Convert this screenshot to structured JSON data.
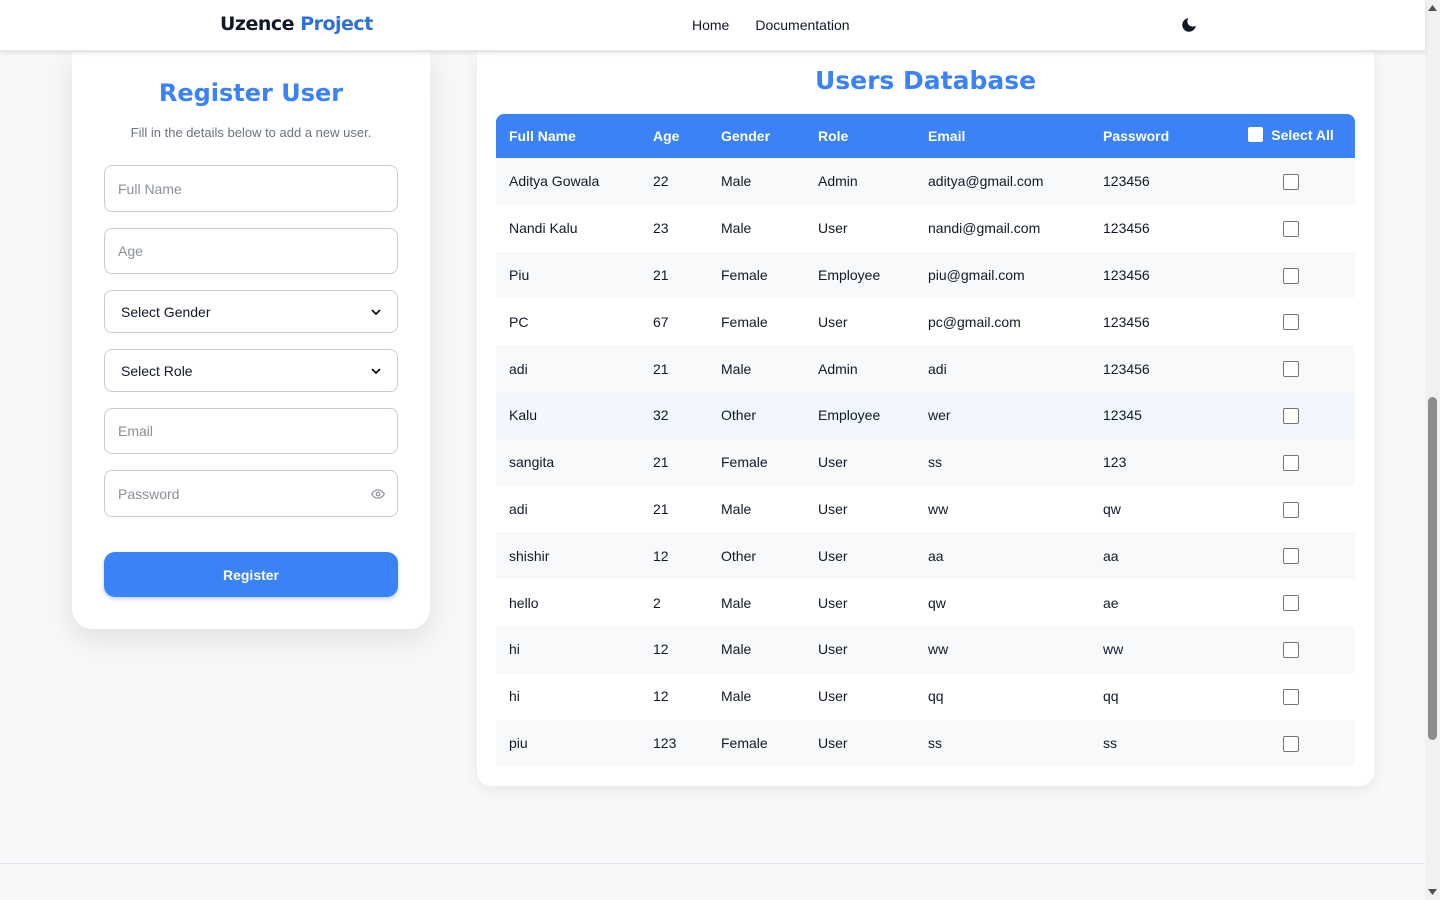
{
  "header": {
    "brand_part1": "Uzence",
    "brand_part2": "Project",
    "nav": [
      "Home",
      "Documentation"
    ],
    "theme_icon": "moon-icon"
  },
  "register": {
    "title": "Register User",
    "subtitle": "Fill in the details below to add a new user.",
    "full_name_placeholder": "Full Name",
    "age_placeholder": "Age",
    "gender_select": "Select Gender",
    "role_select": "Select Role",
    "email_placeholder": "Email",
    "password_placeholder": "Password",
    "password_toggle_icon": "eye-icon",
    "button_label": "Register"
  },
  "database": {
    "title": "Users Database",
    "columns": [
      "Full Name",
      "Age",
      "Gender",
      "Role",
      "Email",
      "Password",
      "Select All"
    ],
    "rows": [
      [
        "Aditya Gowala",
        "22",
        "Male",
        "Admin",
        "aditya@gmail.com",
        "123456"
      ],
      [
        "Nandi Kalu",
        "23",
        "Male",
        "User",
        "nandi@gmail.com",
        "123456"
      ],
      [
        "Piu",
        "21",
        "Female",
        "Employee",
        "piu@gmail.com",
        "123456"
      ],
      [
        "PC",
        "67",
        "Female",
        "User",
        "pc@gmail.com",
        "123456"
      ],
      [
        "adi",
        "21",
        "Male",
        "Admin",
        "adi",
        "123456"
      ],
      [
        "Kalu",
        "32",
        "Other",
        "Employee",
        "wer",
        "12345"
      ],
      [
        "sangita",
        "21",
        "Female",
        "User",
        "ss",
        "123"
      ],
      [
        "adi",
        "21",
        "Male",
        "User",
        "ww",
        "qw"
      ],
      [
        "shishir",
        "12",
        "Other",
        "User",
        "aa",
        "aa"
      ],
      [
        "hello",
        "2",
        "Male",
        "User",
        "qw",
        "ae"
      ],
      [
        "hi",
        "12",
        "Male",
        "User",
        "ww",
        "ww"
      ],
      [
        "hi",
        "12",
        "Male",
        "User",
        "qq",
        "qq"
      ],
      [
        "piu",
        "123",
        "Female",
        "User",
        "ss",
        "ss"
      ]
    ]
  },
  "colors": {
    "accent": "#3b82f6",
    "brand_dark": "#111827",
    "brand_blue": "#2f6fdb",
    "page_bg": "#f7f8fa"
  }
}
